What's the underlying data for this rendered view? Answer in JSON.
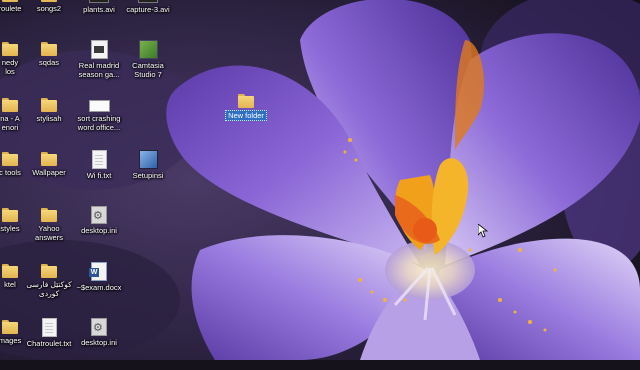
{
  "desktop": {
    "icons": [
      {
        "label": "roulete",
        "icon": "folder-icon"
      },
      {
        "label": "songs2",
        "icon": "folder-icon"
      },
      {
        "label": "plants.avi",
        "icon": "video-file-icon"
      },
      {
        "label": "capture-3.avi",
        "icon": "video-file-icon"
      },
      {
        "label": "nedy\nlos",
        "icon": "folder-icon"
      },
      {
        "label": "sqdas",
        "icon": "folder-icon"
      },
      {
        "label": "Real madrid\nseason ga...",
        "icon": "video-file-icon"
      },
      {
        "label": "Camtasia\nStudio 7",
        "icon": "camtasia-app-icon"
      },
      {
        "label": "na - A\nenori",
        "icon": "folder-icon"
      },
      {
        "label": "stylisah",
        "icon": "folder-icon"
      },
      {
        "label": "sort crashing\nword office...",
        "icon": "word-document-icon"
      },
      {
        "label": "New folder",
        "icon": "folder-icon"
      },
      {
        "label": "c tools",
        "icon": "folder-icon"
      },
      {
        "label": "Wallpaper",
        "icon": "folder-icon"
      },
      {
        "label": "Wi fi.txt",
        "icon": "text-file-icon"
      },
      {
        "label": "Setupinsi",
        "icon": "setup-icon"
      },
      {
        "label": "styles",
        "icon": "folder-icon"
      },
      {
        "label": "Yahoo\nanswers",
        "icon": "folder-icon"
      },
      {
        "label": "desktop.ini",
        "icon": "config-file-icon"
      },
      {
        "label": "ktel",
        "icon": "folder-icon"
      },
      {
        "label": "کوکتێل فارسی\nکوردی",
        "icon": "folder-icon"
      },
      {
        "label": "~$exam.docx",
        "icon": "word-document-icon"
      },
      {
        "label": "mages",
        "icon": "folder-icon"
      },
      {
        "label": "Chatroulet.txt",
        "icon": "text-file-icon"
      },
      {
        "label": "desktop.ini",
        "icon": "config-file-icon"
      }
    ]
  },
  "colors": {
    "selection": "#2f6fc4",
    "petal": "#7a55c8",
    "stamen": "#f0a01a"
  }
}
